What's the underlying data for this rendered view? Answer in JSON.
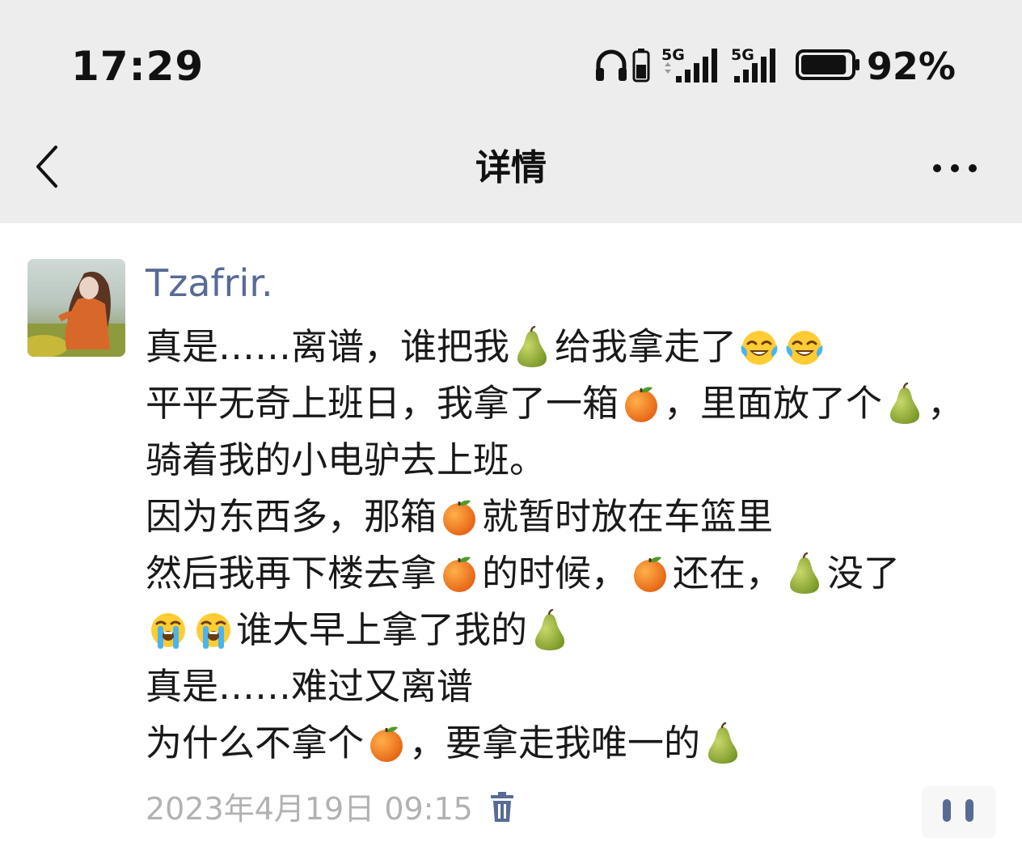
{
  "status_bar": {
    "time": "17:29",
    "signal1_label": "5G",
    "signal2_label": "5G",
    "battery_percent": "92%",
    "battery_level": 0.92,
    "icons": [
      "headphones-icon",
      "small-battery-icon",
      "signal-5g-icon",
      "signal-5g-icon",
      "battery-icon"
    ]
  },
  "nav": {
    "title": "详情",
    "back_icon": "chevron-left-icon",
    "more_icon": "more-dots-icon"
  },
  "post": {
    "username": "Tzafrir.",
    "lines": [
      [
        {
          "t": "text",
          "v": "真是……离谱，谁把我"
        },
        {
          "t": "emoji",
          "v": "pear"
        },
        {
          "t": "text",
          "v": "给我拿走了"
        },
        {
          "t": "emoji",
          "v": "laugh-cry"
        },
        {
          "t": "emoji",
          "v": "laugh-cry"
        }
      ],
      [
        {
          "t": "text",
          "v": "平平无奇上班日，我拿了一箱"
        },
        {
          "t": "emoji",
          "v": "orange"
        },
        {
          "t": "text",
          "v": "，里面放了个"
        },
        {
          "t": "emoji",
          "v": "pear"
        },
        {
          "t": "text",
          "v": "，"
        }
      ],
      [
        {
          "t": "text",
          "v": "骑着我的小电驴去上班。"
        }
      ],
      [
        {
          "t": "text",
          "v": "因为东西多，那箱"
        },
        {
          "t": "emoji",
          "v": "orange"
        },
        {
          "t": "text",
          "v": "就暂时放在车篮里"
        }
      ],
      [
        {
          "t": "text",
          "v": "然后我再下楼去拿"
        },
        {
          "t": "emoji",
          "v": "orange"
        },
        {
          "t": "text",
          "v": "的时候，"
        },
        {
          "t": "emoji",
          "v": "orange"
        },
        {
          "t": "text",
          "v": "还在，"
        },
        {
          "t": "emoji",
          "v": "pear"
        },
        {
          "t": "text",
          "v": "没了"
        }
      ],
      [
        {
          "t": "emoji",
          "v": "loud-cry"
        },
        {
          "t": "emoji",
          "v": "loud-cry"
        },
        {
          "t": "text",
          "v": "谁大早上拿了我的"
        },
        {
          "t": "emoji",
          "v": "pear"
        }
      ],
      [
        {
          "t": "text",
          "v": "真是……难过又离谱"
        }
      ],
      [
        {
          "t": "text",
          "v": "为什么不拿个"
        },
        {
          "t": "emoji",
          "v": "orange"
        },
        {
          "t": "text",
          "v": "，要拿走我唯一的"
        },
        {
          "t": "emoji",
          "v": "pear"
        }
      ]
    ],
    "timestamp": "2023年4月19日 09:15",
    "delete_icon": "trash-icon",
    "comment_icon": "comment-dots-icon"
  },
  "colors": {
    "bar_background": "#ededed",
    "username": "#576b95",
    "timestamp": "#b2b2b2",
    "delete_icon": "#576b95"
  }
}
